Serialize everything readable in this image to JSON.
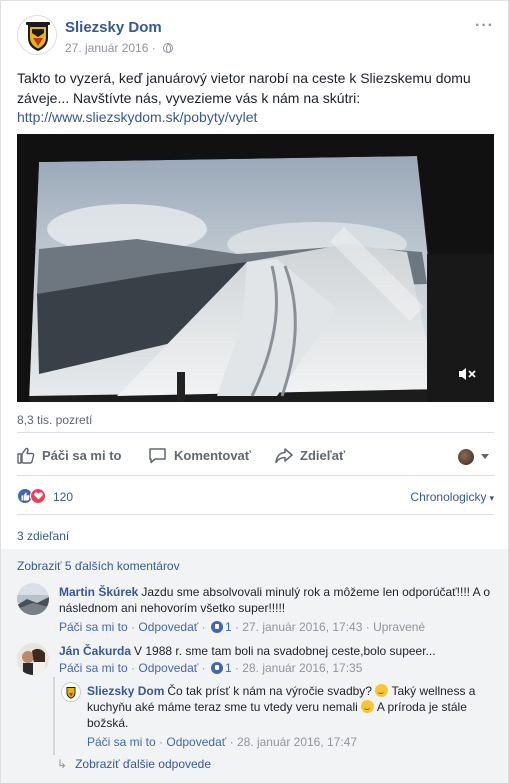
{
  "post": {
    "page_name": "Sliezsky Dom",
    "date": "27. január 2016",
    "separator": " · ",
    "text": "Takto to vyzerá, keď januárový vietor narobí na ceste k Sliezskemu domu záveje... Navštívte nás, vyvezieme vás k nám na skútri:",
    "link": "http://www.sliezskydom.sk/pobyty/vylet",
    "views": "8,3 tis. pozretí",
    "mute_label": "$×"
  },
  "actions": {
    "like": "Páči sa mi to",
    "comment": "Komentovať",
    "share": "Zdieľať"
  },
  "reactions": {
    "count": "120",
    "sort": "Chronologicky",
    "shares": "3 zdieľaní"
  },
  "comments": {
    "more_label": "Zobraziť 5 ďalších komentárov",
    "items": [
      {
        "author": "Martin Škúrek",
        "text": "Jazdu sme absolvovali minulý rok a môžeme len odporúčať!!!! A o následnom ani nehovorím všetko super!!!!!",
        "like": "Páči sa mi to",
        "reply": "Odpovedať",
        "likes": "1",
        "date": "27. január 2016, 17:43",
        "edited": "Upravené"
      },
      {
        "author": "Ján Čakurda",
        "text": "V 1988 r. sme tam boli na svadobnej ceste,bolo supeer...",
        "like": "Páči sa mi to",
        "reply": "Odpovedať",
        "likes": "1",
        "date": "28. január 2016, 17:35"
      }
    ],
    "reply": {
      "author": "Sliezsky Dom",
      "text_a": "Čo tak prísť k nám na výročie svadby?",
      "text_b": "Taký wellness a kuchyňu aké máme teraz sme tu vtedy veru nemali",
      "text_c": "A príroda je stále božská.",
      "like": "Páči sa mi to",
      "reply": "Odpovedať",
      "date": "28. január 2016, 17:47"
    },
    "more_replies": "Zobraziť ďalšie odpovede"
  },
  "colors": {
    "link": "#365899",
    "like_blue": "#4267b2",
    "love_red": "#f33e58",
    "meta_grey": "#90949c"
  }
}
